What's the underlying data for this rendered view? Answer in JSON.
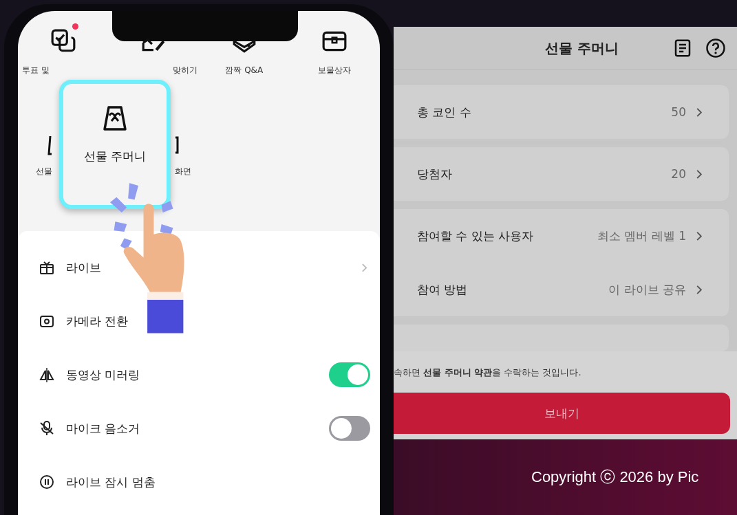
{
  "phone": {
    "features": [
      {
        "label": "투표 및",
        "badge": true
      },
      {
        "label": "맞히기",
        "badge": false
      },
      {
        "label": "깜짝 Q&A",
        "badge": false
      },
      {
        "label": "보물상자",
        "badge": false
      },
      {
        "label": "선물",
        "badge": false
      },
      {
        "label": "화면",
        "badge": false
      }
    ],
    "popup": {
      "label": "선물 주머니"
    },
    "menu": [
      {
        "kind": "link",
        "label": "라이브"
      },
      {
        "kind": "plain",
        "label": "카메라 전환"
      },
      {
        "kind": "toggle",
        "label": "동영상 미러링",
        "on": true
      },
      {
        "kind": "toggle",
        "label": "마이크 음소거",
        "on": false
      },
      {
        "kind": "plain",
        "label": "라이브 잠시 멈춤"
      }
    ]
  },
  "gift_pouch": {
    "title": "선물 주머니",
    "cards": [
      [
        {
          "label": "총 코인 수",
          "value": "50"
        }
      ],
      [
        {
          "label": "당첨자",
          "value": "20"
        }
      ],
      [
        {
          "label": "참여할 수 있는 사용자",
          "value": "최소 멤버 레벨 1"
        },
        {
          "label": "참여 방법",
          "value": "이 라이브 공유"
        }
      ]
    ],
    "terms": "속하면 **선물 주머니 약관**을 수락하는 것입니다.",
    "send_button": "보내기"
  },
  "footer": {
    "copyright": "Copyright ⓒ 2026 by Pic"
  }
}
